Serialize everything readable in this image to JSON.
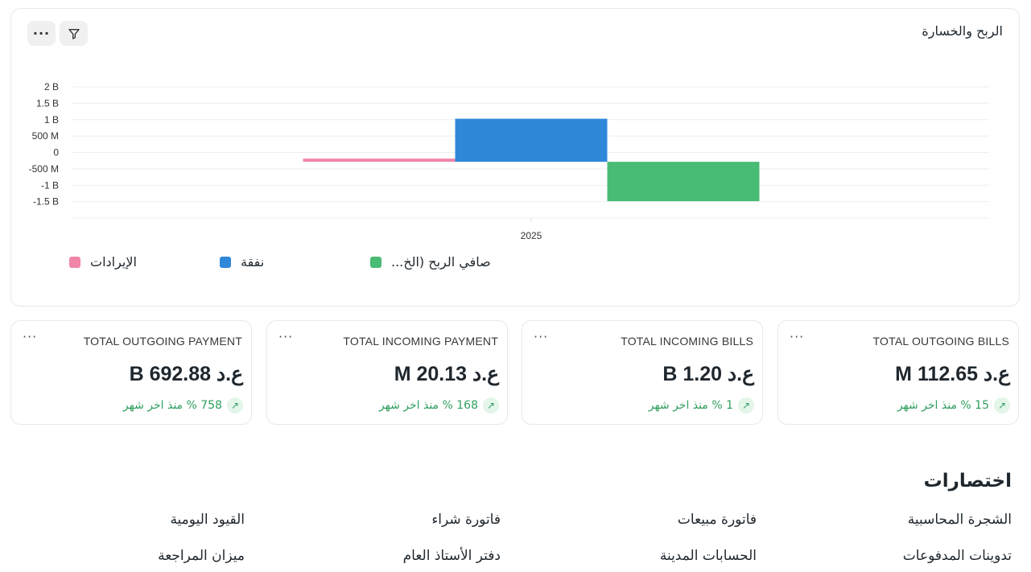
{
  "chart_card": {
    "title": "الربح والخسارة",
    "more_icon": "more-horizontal-icon",
    "filter_icon": "filter-icon"
  },
  "chart_data": {
    "type": "bar",
    "categories": [
      "2025"
    ],
    "series": [
      {
        "name": "الإيرادات",
        "values": [
          0.07
        ],
        "color": "#f086a8"
      },
      {
        "name": "نفقة",
        "values": [
          1.15
        ],
        "color": "#3088d9"
      },
      {
        "name": "...صافي الربح (الخ",
        "values": [
          -1.05
        ],
        "color": "#48bb74"
      }
    ],
    "ytick_labels": [
      "2 B",
      "1.5 B",
      "1 B",
      "500 M",
      "0",
      "-500 M",
      "-1 B",
      "-1.5 B"
    ],
    "ylim": [
      -1.5,
      2
    ],
    "units": "B",
    "grid": true,
    "legend": "bottom"
  },
  "stats": [
    {
      "title": "TOTAL OUTGOING BILLS",
      "value": "ع.د 112.65 M",
      "change": "15 % منذ اخر شهر"
    },
    {
      "title": "TOTAL INCOMING BILLS",
      "value": "ع.د 1.20 B",
      "change": "1 % منذ اخر شهر"
    },
    {
      "title": "TOTAL INCOMING PAYMENT",
      "value": "ع.د 20.13 M",
      "change": "168 % منذ اخر شهر"
    },
    {
      "title": "TOTAL OUTGOING PAYMENT",
      "value": "ع.د 692.88 B",
      "change": "758 % منذ اخر شهر"
    }
  ],
  "stat_more": "···",
  "arrow_glyph": "↗",
  "shortcuts": {
    "title": "اختصارات",
    "items": [
      "الشجرة المحاسبية",
      "فاتورة مبيعات",
      "فاتورة شراء",
      "القيود اليومية",
      "تدوينات المدفوعات",
      "الحسابات المدينة",
      "دفتر الأستاذ العام",
      "ميزان المراجعة"
    ]
  }
}
